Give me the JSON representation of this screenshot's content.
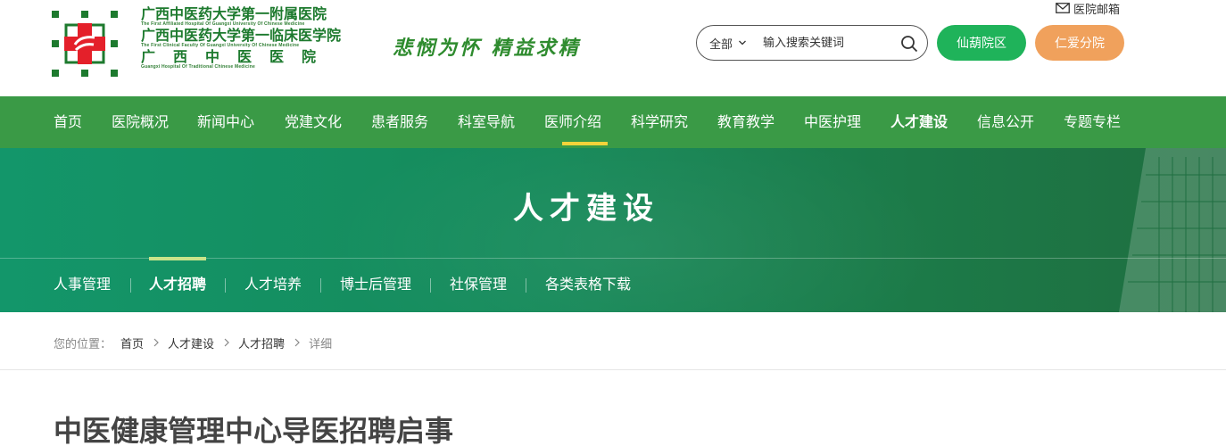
{
  "header": {
    "logo": {
      "line1": "广西中医药大学第一附属医院",
      "line1_en": "The First Affiliated Hospital Of Guangxi University Of Chinese Medicine",
      "line2": "广西中医药大学第一临床医学院",
      "line2_en": "The First Clinical Faculty Of Guangxi University Of Chinese Medicine",
      "line3": "广西中医医院",
      "line3_en": "Guangxi Hospital Of Traditional Chinese Medicine"
    },
    "motto": "悲悯为怀 精益求精",
    "mailbox_label": "医院邮箱",
    "search": {
      "scope": "全部",
      "placeholder": "输入搜索关键词"
    },
    "campus_buttons": [
      "仙葫院区",
      "仁爱分院"
    ],
    "colors": {
      "brand_green": "#3a9a46",
      "campus_green": "#1fb35a",
      "campus_orange": "#f0a15c"
    }
  },
  "nav": {
    "items": [
      "首页",
      "医院概况",
      "新闻中心",
      "党建文化",
      "患者服务",
      "科室导航",
      "医师介绍",
      "科学研究",
      "教育教学",
      "中医护理",
      "人才建设",
      "信息公开",
      "专题专栏"
    ],
    "underlined": "医师介绍",
    "active": "人才建设"
  },
  "banner": {
    "title": "人才建设",
    "subnav": [
      "人事管理",
      "人才招聘",
      "人才培养",
      "博士后管理",
      "社保管理",
      "各类表格下载"
    ],
    "active": "人才招聘"
  },
  "breadcrumb": {
    "lead": "您的位置：",
    "items": [
      "首页",
      "人才建设",
      "人才招聘",
      "详细"
    ]
  },
  "article": {
    "title": "中医健康管理中心导医招聘启事"
  }
}
